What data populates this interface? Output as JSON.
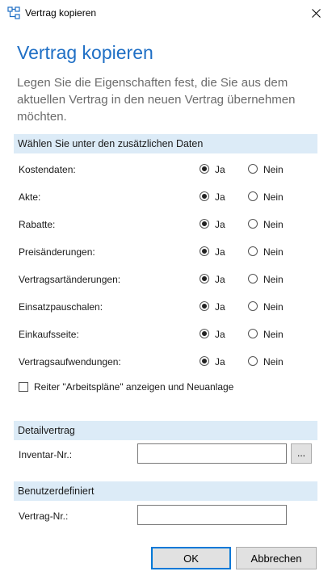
{
  "window": {
    "title": "Vertrag kopieren",
    "app_icon": "sitemap-icon",
    "close_icon": "close-icon"
  },
  "heading": "Vertrag kopieren",
  "description": "Legen Sie die Eigenschaften fest, die Sie aus dem aktuellen Vertrag in den neuen Vertrag übernehmen möchten.",
  "sections": {
    "zusatz": "Wählen Sie unter den zusätzlichen Daten",
    "detail": "Detailvertrag",
    "benutzer": "Benutzerdefiniert"
  },
  "radio_labels": {
    "ja": "Ja",
    "nein": "Nein"
  },
  "options": [
    {
      "label": "Kostendaten:",
      "selected": "Ja"
    },
    {
      "label": "Akte:",
      "selected": "Ja"
    },
    {
      "label": "Rabatte:",
      "selected": "Ja"
    },
    {
      "label": "Preisänderungen:",
      "selected": "Ja"
    },
    {
      "label": "Vertragsartänderungen:",
      "selected": "Ja"
    },
    {
      "label": "Einsatzpauschalen:",
      "selected": "Ja"
    },
    {
      "label": "Einkaufsseite:",
      "selected": "Ja"
    },
    {
      "label": "Vertragsaufwendungen:",
      "selected": "Ja"
    }
  ],
  "checkbox": {
    "label": "Reiter \"Arbeitspläne\" anzeigen und Neuanlage",
    "checked": false
  },
  "fields": {
    "inventar": {
      "label": "Inventar-Nr.:",
      "value": "",
      "browse_label": "..."
    },
    "vertrag": {
      "label": "Vertrag-Nr.:",
      "value": ""
    }
  },
  "buttons": {
    "ok": "OK",
    "cancel": "Abbrechen"
  }
}
